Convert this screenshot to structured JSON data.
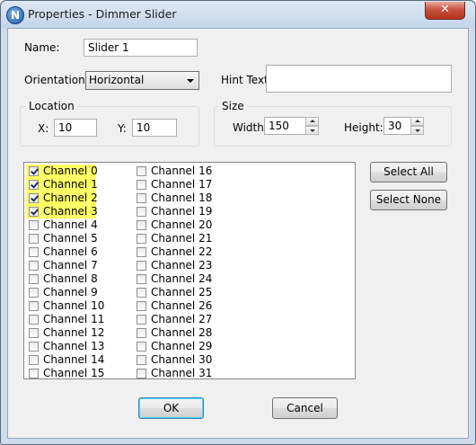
{
  "window": {
    "title": "Properties - Dimmer Slider",
    "app_icon_letter": "N",
    "close_glyph": "✕"
  },
  "form": {
    "name_label": "Name:",
    "name_value": "Slider 1",
    "orientation_label": "Orientation:",
    "orientation_value": "Horizontal",
    "hint_label": "Hint Text:",
    "hint_value": "",
    "location": {
      "title": "Location",
      "x_label": "X:",
      "x_value": "10",
      "y_label": "Y:",
      "y_value": "10"
    },
    "size": {
      "title": "Size",
      "width_label": "Width:",
      "width_value": "150",
      "height_label": "Height:",
      "height_value": "30"
    }
  },
  "channels": [
    {
      "label": "Channel 0",
      "checked": true
    },
    {
      "label": "Channel 1",
      "checked": true
    },
    {
      "label": "Channel 2",
      "checked": true
    },
    {
      "label": "Channel 3",
      "checked": true
    },
    {
      "label": "Channel 4",
      "checked": false
    },
    {
      "label": "Channel 5",
      "checked": false
    },
    {
      "label": "Channel 6",
      "checked": false
    },
    {
      "label": "Channel 7",
      "checked": false
    },
    {
      "label": "Channel 8",
      "checked": false
    },
    {
      "label": "Channel 9",
      "checked": false
    },
    {
      "label": "Channel 10",
      "checked": false
    },
    {
      "label": "Channel 11",
      "checked": false
    },
    {
      "label": "Channel 12",
      "checked": false
    },
    {
      "label": "Channel 13",
      "checked": false
    },
    {
      "label": "Channel 14",
      "checked": false
    },
    {
      "label": "Channel 15",
      "checked": false
    },
    {
      "label": "Channel 16",
      "checked": false
    },
    {
      "label": "Channel 17",
      "checked": false
    },
    {
      "label": "Channel 18",
      "checked": false
    },
    {
      "label": "Channel 19",
      "checked": false
    },
    {
      "label": "Channel 20",
      "checked": false
    },
    {
      "label": "Channel 21",
      "checked": false
    },
    {
      "label": "Channel 22",
      "checked": false
    },
    {
      "label": "Channel 23",
      "checked": false
    },
    {
      "label": "Channel 24",
      "checked": false
    },
    {
      "label": "Channel 25",
      "checked": false
    },
    {
      "label": "Channel 26",
      "checked": false
    },
    {
      "label": "Channel 27",
      "checked": false
    },
    {
      "label": "Channel 28",
      "checked": false
    },
    {
      "label": "Channel 29",
      "checked": false
    },
    {
      "label": "Channel 30",
      "checked": false
    },
    {
      "label": "Channel 31",
      "checked": false
    }
  ],
  "buttons": {
    "select_all": "Select All",
    "select_none": "Select None",
    "ok": "OK",
    "cancel": "Cancel"
  },
  "colors": {
    "highlight": "#ffff66",
    "titlebar": "#c4d5ea",
    "close": "#c7533f"
  }
}
